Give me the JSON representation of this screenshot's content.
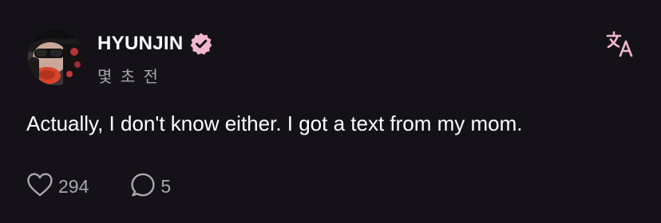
{
  "post": {
    "author": {
      "name": "HYUNJIN",
      "verified_icon": "verified-badge-icon",
      "avatar_icon": "avatar"
    },
    "timestamp": "몇 초 전",
    "content": "Actually, I don't know either. I got a text from my mom.",
    "translate_icon": "translate-icon",
    "actions": {
      "like_icon": "heart-icon",
      "like_count": "294",
      "reply_icon": "comment-icon",
      "reply_count": "5"
    }
  },
  "colors": {
    "background": "#141218",
    "text_primary": "#ffffff",
    "text_secondary": "#a9a6ad",
    "accent_pink": "#f2b6cf"
  }
}
